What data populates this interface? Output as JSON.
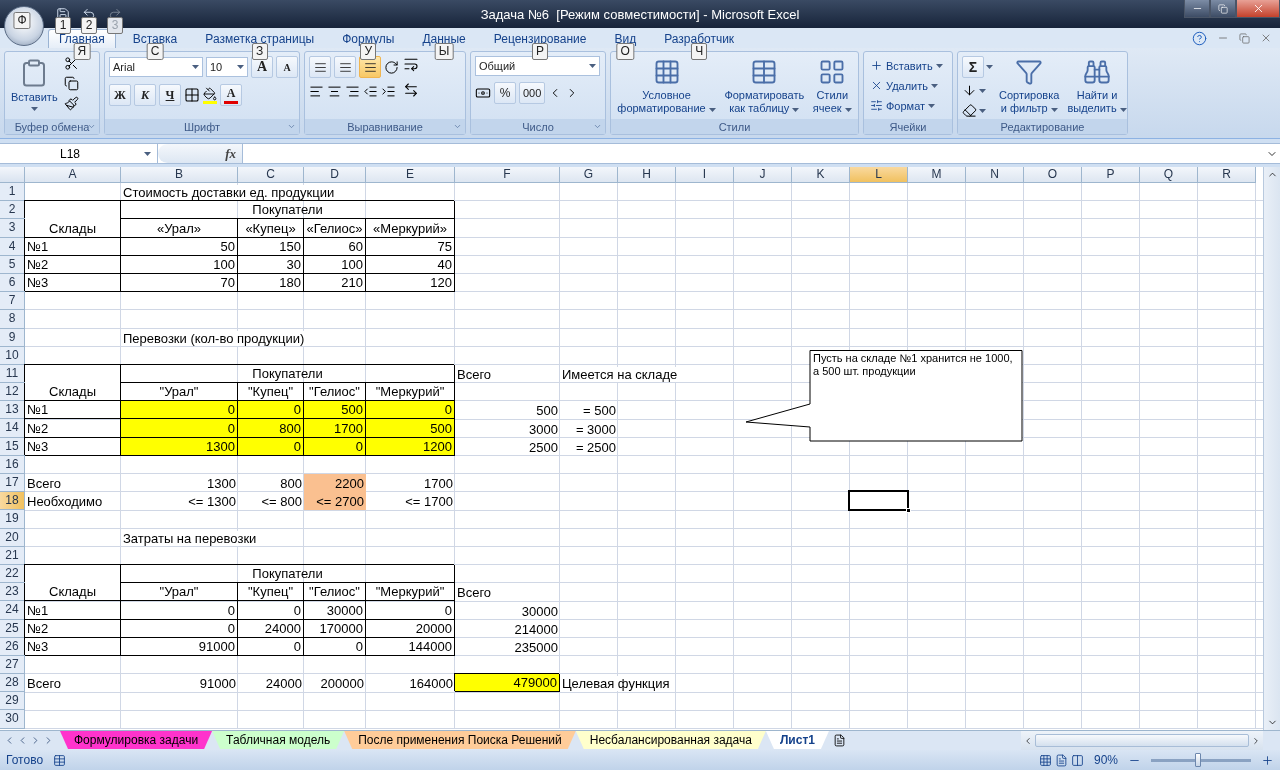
{
  "window": {
    "title": "Задача №6  [Режим совместимости] - Microsoft Excel",
    "office_keytip": "Ф"
  },
  "quick_access": [
    {
      "keytip": "1",
      "disabled": false
    },
    {
      "keytip": "2",
      "disabled": false
    },
    {
      "keytip": "3",
      "disabled": true
    }
  ],
  "ribbon_tabs": [
    {
      "label": "Главная",
      "keytip": "Я",
      "selected": true
    },
    {
      "label": "Вставка",
      "keytip": "С",
      "selected": false
    },
    {
      "label": "Разметка страницы",
      "keytip": "З",
      "selected": false
    },
    {
      "label": "Формулы",
      "keytip": "У",
      "selected": false
    },
    {
      "label": "Данные",
      "keytip": "Ы",
      "selected": false
    },
    {
      "label": "Рецензирование",
      "keytip": "Р",
      "selected": false
    },
    {
      "label": "Вид",
      "keytip": "О",
      "selected": false
    },
    {
      "label": "Разработчик",
      "keytip": "Ч",
      "selected": false
    }
  ],
  "clipboard": {
    "label": "Буфер обмена",
    "paste": "Вставить"
  },
  "font": {
    "label": "Шрифт",
    "name": "Arial",
    "size": "10",
    "grow": "A",
    "shrink": "A",
    "bold": "Ж",
    "italic": "К",
    "underline": "Ч",
    "color_letter": "A"
  },
  "alignment": {
    "label": "Выравнивание",
    "vertical": [
      {
        "selected": false
      },
      {
        "selected": false
      },
      {
        "selected": true
      }
    ]
  },
  "number": {
    "label": "Число",
    "format": "Общий",
    "percent": "%",
    "thousands": "000"
  },
  "styles": {
    "label": "Стили",
    "buttons": [
      [
        "Условное",
        "форматирование"
      ],
      [
        "Форматировать",
        "как таблицу"
      ],
      [
        "Стили",
        "ячеек"
      ]
    ]
  },
  "cells": {
    "label": "Ячейки",
    "buttons": [
      "Вставить",
      "Удалить",
      "Формат"
    ]
  },
  "editing": {
    "label": "Редактирование",
    "sum": "Σ",
    "buttons": [
      [
        "Сортировка",
        "и фильтр"
      ],
      [
        "Найти и",
        "выделить"
      ]
    ]
  },
  "formula_bar": {
    "name_box": "L18",
    "fx": "fx"
  },
  "columns": [
    {
      "label": "A",
      "selected": false
    },
    {
      "label": "B",
      "selected": false
    },
    {
      "label": "C",
      "selected": false
    },
    {
      "label": "D",
      "selected": false
    },
    {
      "label": "E",
      "selected": false
    },
    {
      "label": "F",
      "selected": false
    },
    {
      "label": "G",
      "selected": false
    },
    {
      "label": "H",
      "selected": false
    },
    {
      "label": "I",
      "selected": false
    },
    {
      "label": "J",
      "selected": false
    },
    {
      "label": "K",
      "selected": false
    },
    {
      "label": "L",
      "selected": true
    },
    {
      "label": "M",
      "selected": false
    },
    {
      "label": "N",
      "selected": false
    },
    {
      "label": "O",
      "selected": false
    },
    {
      "label": "P",
      "selected": false
    },
    {
      "label": "Q",
      "selected": false
    },
    {
      "label": "R",
      "selected": false
    }
  ],
  "rows": [
    {
      "number": "1",
      "selected": false,
      "cells": [
        {},
        {
          "kind": "label",
          "text": "Стоимость доставки ед. продукции"
        }
      ]
    },
    {
      "number": "2",
      "selected": false,
      "cells": [
        {
          "kind": "merge-top"
        },
        {
          "kind": "wide",
          "text": "Покупатели"
        }
      ]
    },
    {
      "number": "3",
      "selected": false,
      "cells": [
        {
          "kind": "merge-bottom",
          "text": "Склады"
        },
        {
          "kind": "header",
          "text": "«Урал»"
        },
        {
          "kind": "header",
          "text": "«Купец»"
        },
        {
          "kind": "header",
          "text": "«Гелиос»"
        },
        {
          "kind": "header",
          "text": "«Меркурий»"
        }
      ]
    },
    {
      "number": "4",
      "selected": false,
      "cells": [
        {
          "kind": "label",
          "boxed": true,
          "text": "№1"
        },
        {
          "kind": "number",
          "boxed": true,
          "text": "50"
        },
        {
          "kind": "number",
          "boxed": true,
          "text": "150"
        },
        {
          "kind": "number",
          "boxed": true,
          "text": "60"
        },
        {
          "kind": "number",
          "boxed": true,
          "text": "75"
        }
      ]
    },
    {
      "number": "5",
      "selected": false,
      "cells": [
        {
          "kind": "label",
          "boxed": true,
          "text": "№2"
        },
        {
          "kind": "number",
          "boxed": true,
          "text": "100"
        },
        {
          "kind": "number",
          "boxed": true,
          "text": "30"
        },
        {
          "kind": "number",
          "boxed": true,
          "text": "100"
        },
        {
          "kind": "number",
          "boxed": true,
          "text": "40"
        }
      ]
    },
    {
      "number": "6",
      "selected": false,
      "cells": [
        {
          "kind": "label",
          "boxed": true,
          "text": "№3"
        },
        {
          "kind": "number",
          "boxed": true,
          "text": "70"
        },
        {
          "kind": "number",
          "boxed": true,
          "text": "180"
        },
        {
          "kind": "number",
          "boxed": true,
          "text": "210"
        },
        {
          "kind": "number",
          "boxed": true,
          "text": "120"
        }
      ]
    },
    {
      "number": "7",
      "selected": false,
      "cells": []
    },
    {
      "number": "8",
      "selected": false,
      "cells": []
    },
    {
      "number": "9",
      "selected": false,
      "cells": [
        {},
        {
          "kind": "label",
          "text": "Перевозки (кол-во продукции)"
        }
      ]
    },
    {
      "number": "10",
      "selected": false,
      "cells": []
    },
    {
      "number": "11",
      "selected": false,
      "cells": [
        {
          "kind": "merge-top"
        },
        {
          "kind": "wide",
          "text": "Покупатели"
        },
        {
          "kind": "label",
          "text": "Всего"
        },
        {
          "kind": "label",
          "text": "Имеется на складе"
        }
      ]
    },
    {
      "number": "12",
      "selected": false,
      "cells": [
        {
          "kind": "merge-bottom",
          "text": "Склады"
        },
        {
          "kind": "header",
          "text": "\"Урал\""
        },
        {
          "kind": "header",
          "text": "\"Купец\""
        },
        {
          "kind": "header",
          "text": "\"Гелиос\""
        },
        {
          "kind": "header",
          "text": "\"Меркурий\""
        }
      ]
    },
    {
      "number": "13",
      "selected": false,
      "cells": [
        {
          "kind": "label",
          "boxed": true,
          "text": "№1"
        },
        {
          "kind": "number",
          "boxed": true,
          "color": "#ffff00",
          "text": "0"
        },
        {
          "kind": "number",
          "boxed": true,
          "color": "#ffff00",
          "text": "0"
        },
        {
          "kind": "number",
          "boxed": true,
          "color": "#ffff00",
          "text": "500"
        },
        {
          "kind": "number",
          "boxed": true,
          "color": "#ffff00",
          "text": "0"
        },
        {
          "kind": "number",
          "text": "500"
        },
        {
          "kind": "number",
          "text": "= 500"
        }
      ]
    },
    {
      "number": "14",
      "selected": false,
      "cells": [
        {
          "kind": "label",
          "boxed": true,
          "text": "№2"
        },
        {
          "kind": "number",
          "boxed": true,
          "color": "#ffff00",
          "text": "0"
        },
        {
          "kind": "number",
          "boxed": true,
          "color": "#ffff00",
          "text": "800"
        },
        {
          "kind": "number",
          "boxed": true,
          "color": "#ffff00",
          "text": "1700"
        },
        {
          "kind": "number",
          "boxed": true,
          "color": "#ffff00",
          "text": "500"
        },
        {
          "kind": "number",
          "text": "3000"
        },
        {
          "kind": "number",
          "text": "= 3000"
        }
      ]
    },
    {
      "number": "15",
      "selected": false,
      "cells": [
        {
          "kind": "label",
          "boxed": true,
          "text": "№3"
        },
        {
          "kind": "number",
          "boxed": true,
          "color": "#ffff00",
          "text": "1300"
        },
        {
          "kind": "number",
          "boxed": true,
          "color": "#ffff00",
          "text": "0"
        },
        {
          "kind": "number",
          "boxed": true,
          "color": "#ffff00",
          "text": "0"
        },
        {
          "kind": "number",
          "boxed": true,
          "color": "#ffff00",
          "text": "1200"
        },
        {
          "kind": "number",
          "text": "2500"
        },
        {
          "kind": "number",
          "text": "= 2500"
        }
      ]
    },
    {
      "number": "16",
      "selected": false,
      "cells": []
    },
    {
      "number": "17",
      "selected": false,
      "cells": [
        {
          "kind": "label",
          "text": "Всего"
        },
        {
          "kind": "number",
          "text": "1300"
        },
        {
          "kind": "number",
          "text": "800"
        },
        {
          "kind": "number",
          "color": "#fac090",
          "text": "2200"
        },
        {
          "kind": "number",
          "text": "1700"
        }
      ]
    },
    {
      "number": "18",
      "selected": true,
      "cells": [
        {
          "kind": "label",
          "text": "Необходимо"
        },
        {
          "kind": "number",
          "text": "<= 1300"
        },
        {
          "kind": "number",
          "text": "<= 800"
        },
        {
          "kind": "number",
          "color": "#fac090",
          "text": "<= 2700"
        },
        {
          "kind": "number",
          "text": "<= 1700"
        }
      ]
    },
    {
      "number": "19",
      "selected": false,
      "cells": []
    },
    {
      "number": "20",
      "selected": false,
      "cells": [
        {},
        {
          "kind": "label",
          "text": "Затраты на перевозки"
        }
      ]
    },
    {
      "number": "21",
      "selected": false,
      "cells": []
    },
    {
      "number": "22",
      "selected": false,
      "cells": [
        {
          "kind": "merge-top"
        },
        {
          "kind": "wide",
          "text": "Покупатели"
        }
      ]
    },
    {
      "number": "23",
      "selected": false,
      "cells": [
        {
          "kind": "merge-bottom",
          "text": "Склады"
        },
        {
          "kind": "header",
          "text": "\"Урал\""
        },
        {
          "kind": "header",
          "text": "\"Купец\""
        },
        {
          "kind": "header",
          "text": "\"Гелиос\""
        },
        {
          "kind": "header",
          "text": "\"Меркурий\""
        },
        {
          "kind": "label",
          "text": "Всего"
        }
      ]
    },
    {
      "number": "24",
      "selected": false,
      "cells": [
        {
          "kind": "label",
          "boxed": true,
          "text": "№1"
        },
        {
          "kind": "number",
          "boxed": true,
          "text": "0"
        },
        {
          "kind": "number",
          "boxed": true,
          "text": "0"
        },
        {
          "kind": "number",
          "boxed": true,
          "text": "30000"
        },
        {
          "kind": "number",
          "boxed": true,
          "text": "0"
        },
        {
          "kind": "number",
          "text": "30000"
        }
      ]
    },
    {
      "number": "25",
      "selected": false,
      "cells": [
        {
          "kind": "label",
          "boxed": true,
          "text": "№2"
        },
        {
          "kind": "number",
          "boxed": true,
          "text": "0"
        },
        {
          "kind": "number",
          "boxed": true,
          "text": "24000"
        },
        {
          "kind": "number",
          "boxed": true,
          "text": "170000"
        },
        {
          "kind": "number",
          "boxed": true,
          "text": "20000"
        },
        {
          "kind": "number",
          "text": "214000"
        }
      ]
    },
    {
      "number": "26",
      "selected": false,
      "cells": [
        {
          "kind": "label",
          "boxed": true,
          "text": "№3"
        },
        {
          "kind": "number",
          "boxed": true,
          "text": "91000"
        },
        {
          "kind": "number",
          "boxed": true,
          "text": "0"
        },
        {
          "kind": "number",
          "boxed": true,
          "text": "0"
        },
        {
          "kind": "number",
          "boxed": true,
          "text": "144000"
        },
        {
          "kind": "number",
          "text": "235000"
        }
      ]
    },
    {
      "number": "27",
      "selected": false,
      "cells": []
    },
    {
      "number": "28",
      "selected": false,
      "cells": [
        {
          "kind": "label",
          "text": "Всего"
        },
        {
          "kind": "number",
          "text": "91000"
        },
        {
          "kind": "number",
          "text": "24000"
        },
        {
          "kind": "number",
          "text": "200000"
        },
        {
          "kind": "number",
          "text": "164000"
        },
        {
          "kind": "number",
          "boxed": true,
          "color": "#ffff00",
          "text": "479000"
        },
        {
          "kind": "label",
          "text": "Целевая функция"
        }
      ]
    },
    {
      "number": "29",
      "selected": false,
      "cells": []
    },
    {
      "number": "30",
      "selected": false,
      "cells": []
    }
  ],
  "callout": {
    "text": "Пусть на складе №1 хранится не 1000, а 500 шт. продукции"
  },
  "sheet_tabs": [
    {
      "label": "Формулировка задачи",
      "color": "#ff33cc",
      "selected": false
    },
    {
      "label": "Табличная модель",
      "color": "#ccffcc",
      "selected": false
    },
    {
      "label": "После применения Поиска Решений",
      "color": "#ffcc99",
      "selected": false
    },
    {
      "label": "Несбалансированная задача",
      "color": "#ffffcc",
      "selected": false
    },
    {
      "label": "Лист1",
      "color": "#ffffff",
      "selected": true
    }
  ],
  "status_bar": {
    "text": "Готово",
    "zoom": "90%",
    "level": 0.47
  }
}
